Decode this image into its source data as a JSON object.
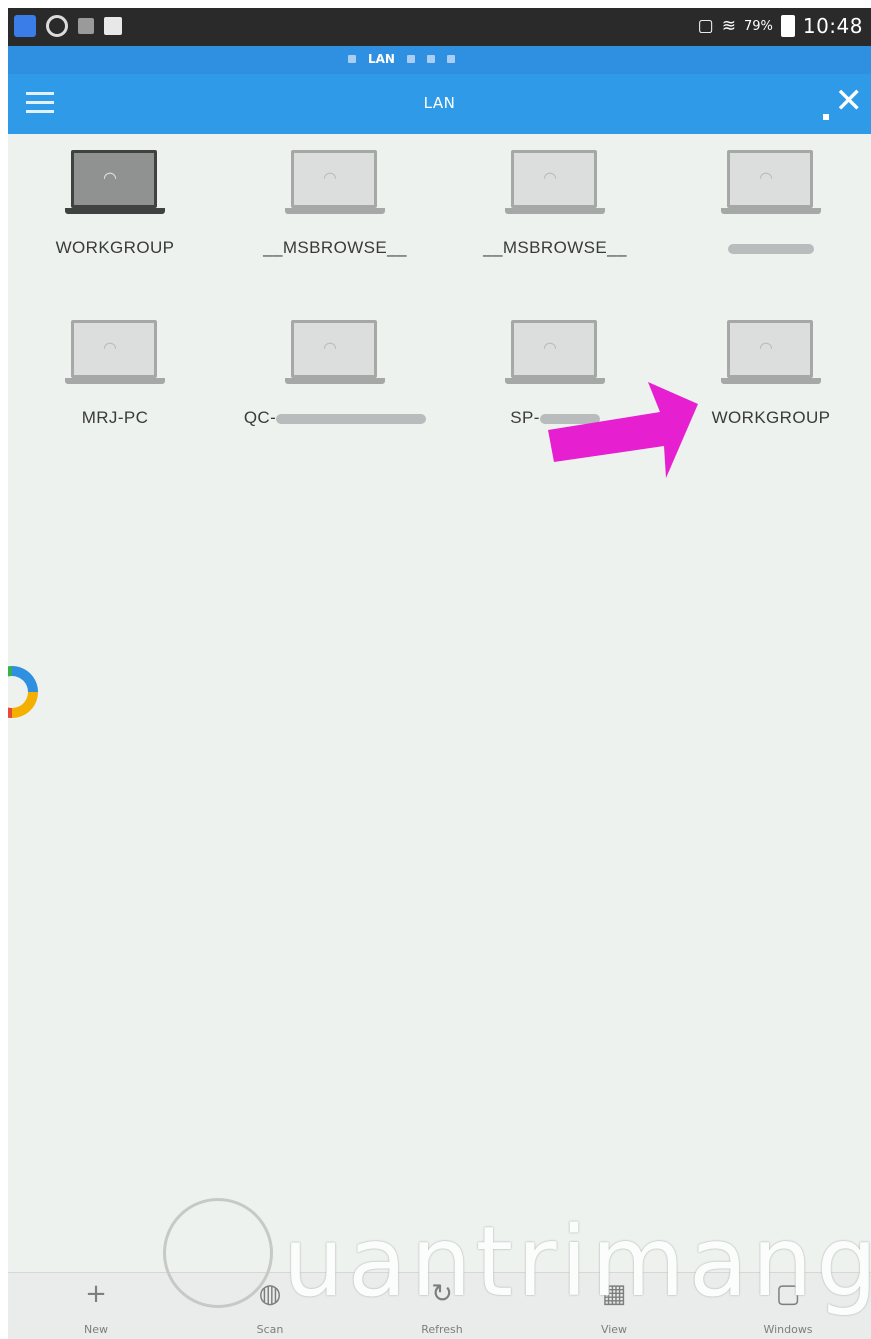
{
  "status_bar": {
    "battery_percent": "79%",
    "time": "10:48"
  },
  "tab_strip": {
    "label": "LAN"
  },
  "toolbar": {
    "title": "LAN"
  },
  "devices": [
    {
      "label": "WORKGROUP",
      "selected": true
    },
    {
      "label": "__MSBROWSE__"
    },
    {
      "label": "__MSBROWSE__"
    },
    {
      "label": ""
    },
    {
      "label": "MRJ-PC"
    },
    {
      "label": "QC-"
    },
    {
      "label": "SP-"
    },
    {
      "label": "WORKGROUP"
    }
  ],
  "bottom_bar": [
    {
      "label": "New",
      "icon": "plus-icon"
    },
    {
      "label": "Scan",
      "icon": "scan-icon"
    },
    {
      "label": "Refresh",
      "icon": "refresh-icon"
    },
    {
      "label": "View",
      "icon": "view-icon"
    },
    {
      "label": "Windows",
      "icon": "windows-icon"
    }
  ],
  "watermark": {
    "text": "uantrimang"
  },
  "colors": {
    "accent": "#2f9be8",
    "annotation_arrow": "#e61fd1"
  }
}
